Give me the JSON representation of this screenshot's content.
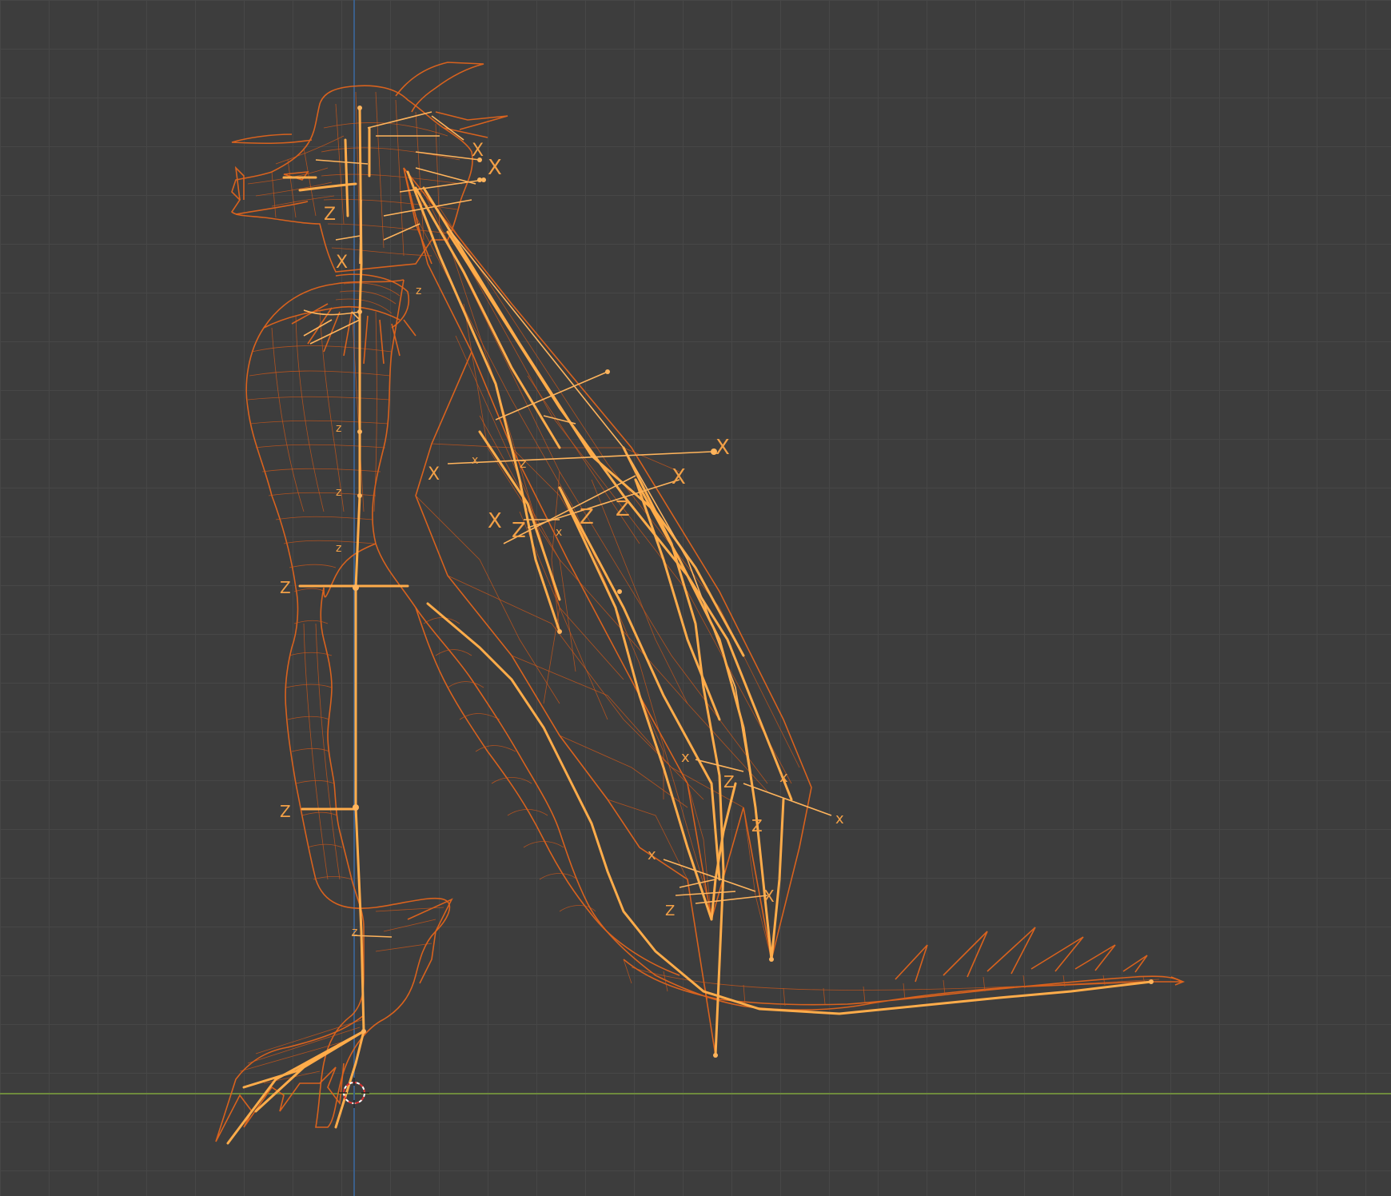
{
  "viewport": {
    "background_color": "#3d3d3d",
    "grid_color": "#474747",
    "x_axis_color": "#6e8b3d",
    "z_axis_color": "#3b5f8a"
  },
  "model": {
    "wire_color": "#e0641c",
    "bone_color": "#ffac4a",
    "bone_axis_labels": {
      "x": "X",
      "z": "Z",
      "x_small": "x",
      "z_small": "z"
    }
  },
  "cursor": {
    "icon": "3d-cursor-icon"
  }
}
